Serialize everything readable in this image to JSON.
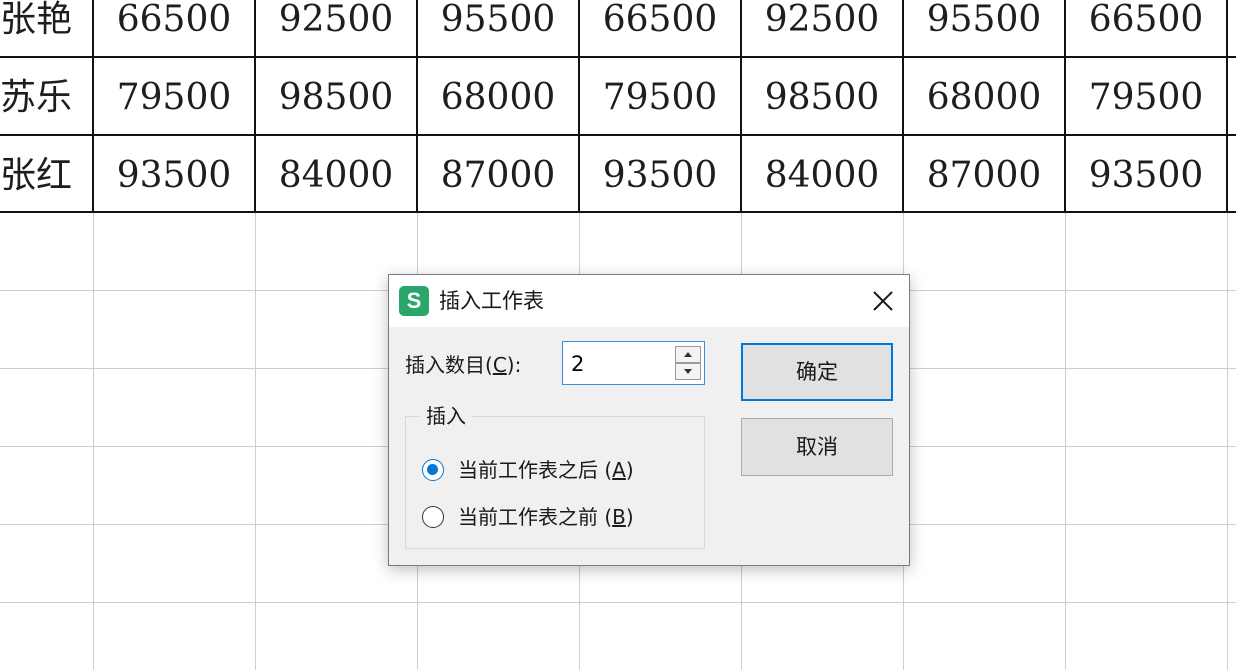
{
  "sheet": {
    "rows": [
      {
        "name": "张艳",
        "values": [
          "66500",
          "92500",
          "95500",
          "66500",
          "92500",
          "95500",
          "66500"
        ]
      },
      {
        "name": "苏乐",
        "values": [
          "79500",
          "98500",
          "68000",
          "79500",
          "98500",
          "68000",
          "79500"
        ]
      },
      {
        "name": "张红",
        "values": [
          "93500",
          "84000",
          "87000",
          "93500",
          "84000",
          "87000",
          "93500"
        ]
      }
    ]
  },
  "dialog": {
    "title": "插入工作表",
    "app_icon_letter": "S",
    "close_icon": "close-icon",
    "count_label_prefix": "插入数目(",
    "count_label_key": "C",
    "count_label_suffix": "):",
    "count_value": "2",
    "ok_label": "确定",
    "cancel_label": "取消",
    "group_title": "插入",
    "option_after_text": "当前工作表之后 (",
    "option_after_key": "A",
    "option_after_suffix": ")",
    "option_before_text": "当前工作表之前 (",
    "option_before_key": "B",
    "option_before_suffix": ")",
    "selected_option": "after"
  },
  "colors": {
    "app_icon": "#2aa66a",
    "accent": "#0078d7"
  }
}
